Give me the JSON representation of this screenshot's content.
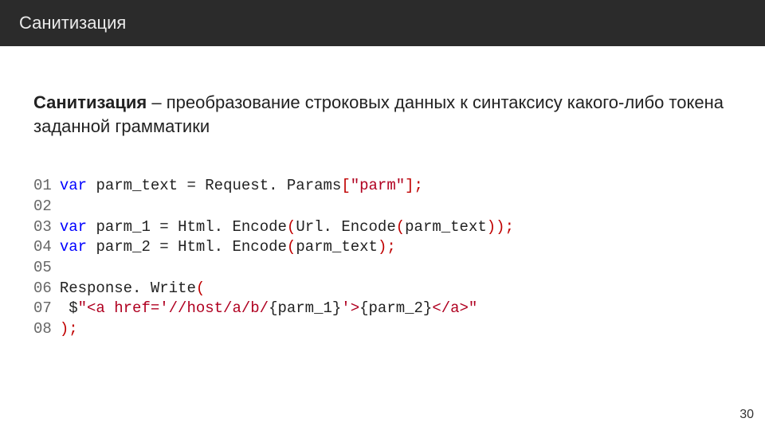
{
  "header": {
    "title": "Санитизация"
  },
  "definition": {
    "term": "Санитизация",
    "dash": " – ",
    "text": "преобразование строковых данных к синтаксису какого-либо токена заданной грамматики"
  },
  "code": {
    "ln01": "01",
    "ln02": "02",
    "ln03": "03",
    "ln04": "04",
    "ln05": "05",
    "ln06": "06",
    "ln07": "07",
    "ln08": "08",
    "kw_var": "var",
    "sp": " ",
    "id_parm_text": "parm_text",
    "eq": " = ",
    "req_params": "Request. Params",
    "lbrack": "[",
    "str_parm": "\"parm\"",
    "rbrack_semi": "];",
    "id_parm_1": "parm_1",
    "id_parm_2": "parm_2",
    "html_encode": "Html. Encode",
    "url_encode": "Url. Encode",
    "lp": "(",
    "rp": ")",
    "rp_rp_semi": "));",
    "rp_semi": ");",
    "resp_write": "Response. Write",
    "indent": "  ",
    "dollar": "$",
    "s1": "\"<a href='//host/a/b/",
    "i1": "{parm_1}",
    "s2": "'>",
    "i2": "{parm_2}",
    "s3": "</a>\""
  },
  "page_number": "30"
}
